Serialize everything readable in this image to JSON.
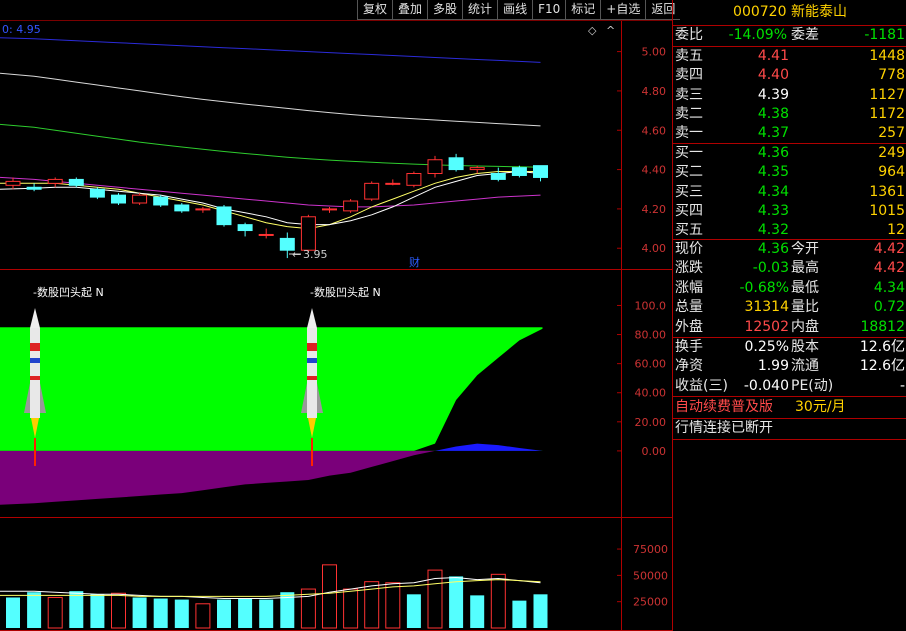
{
  "toolbar": [
    "复权",
    "叠加",
    "多股",
    "统计",
    "画线",
    "F10",
    "标记",
    "+自选",
    "返回"
  ],
  "chart_labels": {
    "main_corner_value": "0: 4.95",
    "low_marker": "3.95",
    "finance_marker": "财",
    "signal_text": "-数股凹头起 N",
    "price_axis": [
      "5.00",
      "4.80",
      "4.60",
      "4.40",
      "4.20",
      "4.00"
    ],
    "indicator_axis": [
      "100.0",
      "80.00",
      "60.00",
      "40.00",
      "20.00",
      "0.00"
    ],
    "volume_axis": [
      "75000",
      "50000",
      "25000"
    ]
  },
  "chart_data": [
    {
      "type": "candlestick",
      "title": "",
      "ylim": [
        3.93,
        5.12
      ],
      "candles": [
        {
          "o": 4.32,
          "c": 4.34,
          "h": 4.36,
          "l": 4.3
        },
        {
          "o": 4.31,
          "c": 4.3,
          "h": 4.33,
          "l": 4.29
        },
        {
          "o": 4.33,
          "c": 4.35,
          "h": 4.36,
          "l": 4.31
        },
        {
          "o": 4.35,
          "c": 4.32,
          "h": 4.36,
          "l": 4.31
        },
        {
          "o": 4.3,
          "c": 4.26,
          "h": 4.31,
          "l": 4.25
        },
        {
          "o": 4.27,
          "c": 4.23,
          "h": 4.28,
          "l": 4.22
        },
        {
          "o": 4.23,
          "c": 4.27,
          "h": 4.28,
          "l": 4.22
        },
        {
          "o": 4.26,
          "c": 4.22,
          "h": 4.27,
          "l": 4.21
        },
        {
          "o": 4.22,
          "c": 4.19,
          "h": 4.23,
          "l": 4.18
        },
        {
          "o": 4.2,
          "c": 4.2,
          "h": 4.21,
          "l": 4.18
        },
        {
          "o": 4.21,
          "c": 4.12,
          "h": 4.22,
          "l": 4.11
        },
        {
          "o": 4.12,
          "c": 4.09,
          "h": 4.13,
          "l": 4.06
        },
        {
          "o": 4.07,
          "c": 4.07,
          "h": 4.1,
          "l": 4.05
        },
        {
          "o": 4.05,
          "c": 3.99,
          "h": 4.08,
          "l": 3.95
        },
        {
          "o": 3.99,
          "c": 4.16,
          "h": 4.17,
          "l": 3.98
        },
        {
          "o": 4.2,
          "c": 4.2,
          "h": 4.21,
          "l": 4.18
        },
        {
          "o": 4.19,
          "c": 4.24,
          "h": 4.25,
          "l": 4.18
        },
        {
          "o": 4.25,
          "c": 4.33,
          "h": 4.34,
          "l": 4.24
        },
        {
          "o": 4.33,
          "c": 4.33,
          "h": 4.35,
          "l": 4.32
        },
        {
          "o": 4.32,
          "c": 4.38,
          "h": 4.39,
          "l": 4.31
        },
        {
          "o": 4.38,
          "c": 4.45,
          "h": 4.47,
          "l": 4.36
        },
        {
          "o": 4.46,
          "c": 4.4,
          "h": 4.48,
          "l": 4.39
        },
        {
          "o": 4.4,
          "c": 4.41,
          "h": 4.42,
          "l": 4.38
        },
        {
          "o": 4.38,
          "c": 4.35,
          "h": 4.41,
          "l": 4.34
        },
        {
          "o": 4.41,
          "c": 4.37,
          "h": 4.42,
          "l": 4.36
        },
        {
          "o": 4.42,
          "c": 4.36,
          "h": 4.42,
          "l": 4.34
        }
      ],
      "series": [
        {
          "values": [
            5.07,
            5.065,
            5.06,
            5.055,
            5.05,
            5.045,
            5.04,
            5.035,
            5.03,
            5.025,
            5.02,
            5.015,
            5.01,
            5.005,
            5.0,
            4.995,
            4.99,
            4.985,
            4.98,
            4.975,
            4.97,
            4.965,
            4.96,
            4.955,
            4.95,
            4.945
          ]
        },
        {
          "values": [
            4.89,
            4.875,
            4.86,
            4.845,
            4.83,
            4.815,
            4.8,
            4.785,
            4.77,
            4.757,
            4.745,
            4.733,
            4.722,
            4.711,
            4.7,
            4.69,
            4.68,
            4.672,
            4.665,
            4.658,
            4.652,
            4.646,
            4.64,
            4.634,
            4.628,
            4.622
          ]
        },
        {
          "values": [
            4.63,
            4.615,
            4.6,
            4.585,
            4.57,
            4.555,
            4.54,
            4.527,
            4.515,
            4.503,
            4.492,
            4.482,
            4.472,
            4.463,
            4.455,
            4.448,
            4.442,
            4.437,
            4.432,
            4.428,
            4.424,
            4.421,
            4.418,
            4.416,
            4.414,
            4.412
          ]
        },
        {
          "values": [
            4.36,
            4.35,
            4.34,
            4.33,
            4.32,
            4.31,
            4.3,
            4.29,
            4.28,
            4.27,
            4.26,
            4.25,
            4.24,
            4.23,
            4.22,
            4.215,
            4.21,
            4.21,
            4.215,
            4.22,
            4.23,
            4.24,
            4.25,
            4.26,
            4.265,
            4.27
          ]
        },
        {
          "values": [
            4.33,
            4.33,
            4.33,
            4.32,
            4.31,
            4.3,
            4.28,
            4.26,
            4.24,
            4.22,
            4.19,
            4.16,
            4.13,
            4.11,
            4.1,
            4.12,
            4.16,
            4.21,
            4.25,
            4.29,
            4.33,
            4.36,
            4.38,
            4.39,
            4.39,
            4.39
          ]
        },
        {
          "values": [
            4.3,
            4.305,
            4.31,
            4.31,
            4.3,
            4.29,
            4.28,
            4.27,
            4.25,
            4.23,
            4.2,
            4.18,
            4.16,
            4.13,
            4.12,
            4.12,
            4.14,
            4.17,
            4.21,
            4.26,
            4.31,
            4.34,
            4.37,
            4.38,
            4.39,
            4.38
          ]
        }
      ]
    },
    {
      "type": "area",
      "title": "",
      "ylim": [
        -42,
        112
      ],
      "signals_at": [
        1,
        14
      ],
      "green_area": [
        85,
        85,
        85,
        85,
        85,
        85,
        85,
        85,
        85,
        85,
        85,
        85,
        85,
        85,
        85,
        85,
        85,
        85,
        85,
        85,
        85,
        85,
        85,
        85,
        85,
        85
      ],
      "black_area": [
        0,
        0,
        0,
        0,
        0,
        0,
        0,
        0,
        0,
        0,
        0,
        0,
        0,
        0,
        0,
        0,
        0,
        0,
        0,
        0,
        5,
        35,
        52,
        64,
        76,
        84
      ],
      "purple_area": [
        -37,
        -36,
        -35,
        -34,
        -33,
        -32,
        -31,
        -30,
        -29,
        -27,
        -25,
        -23,
        -22,
        -21,
        -20,
        -17,
        -15,
        -11,
        -7,
        -3,
        0,
        0,
        0,
        0,
        0,
        0
      ],
      "blue_area": [
        0,
        0,
        0,
        0,
        0,
        0,
        0,
        0,
        0,
        0,
        0,
        0,
        0,
        0,
        0,
        0,
        0,
        0,
        0,
        0,
        0,
        3,
        5,
        4,
        2,
        0
      ]
    },
    {
      "type": "bar",
      "title": "",
      "ylim": [
        0,
        95000
      ],
      "values": [
        29000,
        34000,
        29000,
        35000,
        32000,
        33000,
        29000,
        28000,
        27000,
        23000,
        27000,
        28000,
        27000,
        34000,
        37000,
        60000,
        37000,
        44000,
        43000,
        32000,
        55000,
        49000,
        31000,
        51000,
        26000,
        32000
      ],
      "up": [
        false,
        false,
        true,
        false,
        false,
        true,
        false,
        false,
        false,
        true,
        false,
        false,
        false,
        false,
        true,
        true,
        true,
        true,
        true,
        false,
        true,
        false,
        false,
        true,
        false,
        false
      ],
      "ma1": [
        35000,
        35000,
        34000,
        33000,
        32000,
        32000,
        31000,
        30000,
        30000,
        29000,
        28000,
        28000,
        28000,
        29000,
        30000,
        34000,
        37000,
        40000,
        42000,
        43000,
        47000,
        48000,
        46000,
        47000,
        45000,
        43000
      ],
      "ma2": [
        31000,
        31000,
        31000,
        31000,
        31000,
        31000,
        30000,
        30000,
        30000,
        30000,
        30000,
        30000,
        30000,
        31000,
        32000,
        33000,
        35000,
        37000,
        39000,
        40000,
        42000,
        44000,
        45000,
        46000,
        45000,
        44000
      ]
    }
  ],
  "panel": {
    "title": "000720 新能泰山",
    "weibi": {
      "l1": "委比",
      "v1": "-14.09%",
      "l2": "委差",
      "v2": "-1181"
    },
    "sell": [
      {
        "label": "卖五",
        "price": "4.41",
        "vol": "1448",
        "cls": "red"
      },
      {
        "label": "卖四",
        "price": "4.40",
        "vol": "778",
        "cls": "red"
      },
      {
        "label": "卖三",
        "price": "4.39",
        "vol": "1127",
        "cls": "white"
      },
      {
        "label": "卖二",
        "price": "4.38",
        "vol": "1172",
        "cls": "green"
      },
      {
        "label": "卖一",
        "price": "4.37",
        "vol": "257",
        "cls": "green"
      }
    ],
    "buy": [
      {
        "label": "买一",
        "price": "4.36",
        "vol": "249",
        "cls": "green"
      },
      {
        "label": "买二",
        "price": "4.35",
        "vol": "964",
        "cls": "green"
      },
      {
        "label": "买三",
        "price": "4.34",
        "vol": "1361",
        "cls": "green"
      },
      {
        "label": "买四",
        "price": "4.33",
        "vol": "1015",
        "cls": "green"
      },
      {
        "label": "买五",
        "price": "4.32",
        "vol": "12",
        "cls": "green"
      }
    ],
    "stats": [
      {
        "l1": "现价",
        "v1": "4.36",
        "c1": "green",
        "l2": "今开",
        "v2": "4.42",
        "c2": "red"
      },
      {
        "l1": "涨跌",
        "v1": "-0.03",
        "c1": "green",
        "l2": "最高",
        "v2": "4.42",
        "c2": "red"
      },
      {
        "l1": "涨幅",
        "v1": "-0.68%",
        "c1": "green",
        "l2": "最低",
        "v2": "4.34",
        "c2": "green"
      },
      {
        "l1": "总量",
        "v1": "31314",
        "c1": "yellow",
        "l2": "量比",
        "v2": "0.72",
        "c2": "green"
      },
      {
        "l1": "外盘",
        "v1": "12502",
        "c1": "red",
        "l2": "内盘",
        "v2": "18812",
        "c2": "green"
      }
    ],
    "stats2": [
      {
        "l1": "换手",
        "v1": "0.25%",
        "c1": "white",
        "l2": "股本",
        "v2": "12.6亿",
        "c2": "white"
      },
      {
        "l1": "净资",
        "v1": "1.99",
        "c1": "white",
        "l2": "流通",
        "v2": "12.6亿",
        "c2": "white"
      },
      {
        "l1": "收益(三)",
        "v1": "-0.040",
        "c1": "white",
        "l2": "PE(动)",
        "v2": "-",
        "c2": "white"
      }
    ],
    "promo": "自动续费普及版",
    "promo_price": "30元/月",
    "status": "行情连接已断开"
  }
}
